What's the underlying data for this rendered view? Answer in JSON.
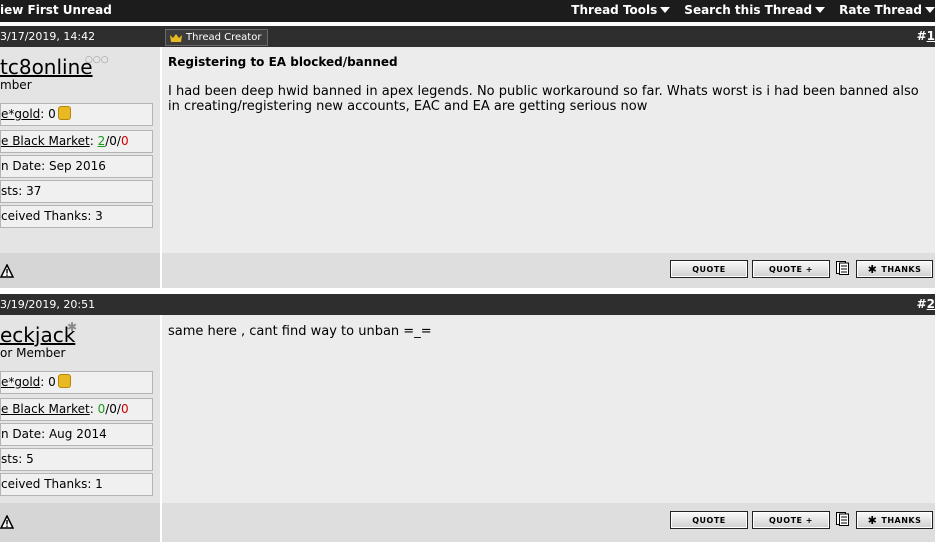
{
  "topbar": {
    "left_label": "iew First Unread",
    "menus": [
      "Thread Tools",
      "Search this Thread",
      "Rate Thread"
    ]
  },
  "posts": [
    {
      "date": "3/17/2019, 14:42",
      "number_prefix": "#",
      "number": "1",
      "creator_badge": "Thread Creator",
      "username": "tc8online",
      "user_title": "mber",
      "stats": {
        "gold_label": "e*gold",
        "gold_value": ": 0",
        "market_label": "e Black Market",
        "market_sep": ": ",
        "market_pos": "2",
        "market_neu": "/0/",
        "market_neg": "0",
        "join": "n Date: Sep 2016",
        "posts": "sts: 37",
        "thanks": "ceived Thanks: 3"
      },
      "title": "Registering to EA blocked/banned",
      "body": "I had been deep hwid banned in apex legends. No public workaround so far. Whats worst is i had been banned also in creating/registering new accounts, EAC and EA are getting serious now"
    },
    {
      "date": "3/19/2019, 20:51",
      "number_prefix": "#",
      "number": "2",
      "username": "eckjack",
      "user_title": "or Member",
      "stats": {
        "gold_label": "e*gold",
        "gold_value": ": 0",
        "market_label": "e Black Market",
        "market_sep": ": ",
        "market_pos": "0",
        "market_neu": "/0/",
        "market_neg": "0",
        "join": "n Date: Aug 2014",
        "posts": "sts: 5",
        "thanks": "ceived Thanks: 1"
      },
      "body": "same here , cant find way to unban =_="
    }
  ],
  "buttons": {
    "quote": "QUOTE",
    "quote_plus": "QUOTE +",
    "thanks": "THANKS"
  },
  "colors": {
    "topbar": "#1c1c1c",
    "header": "#2e2e2e",
    "content": "#ececec",
    "positive": "#1a9a1a",
    "negative": "#cc0000"
  }
}
